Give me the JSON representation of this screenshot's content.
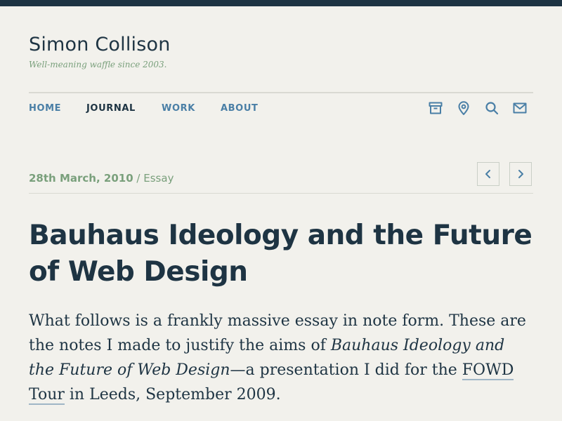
{
  "site": {
    "title": "Simon Collison",
    "tagline": "Well-meaning waffle since 2003."
  },
  "nav": {
    "items": [
      {
        "label": "HOME",
        "active": false
      },
      {
        "label": "JOURNAL",
        "active": true
      },
      {
        "label": "WORK",
        "active": false
      },
      {
        "label": "ABOUT",
        "active": false
      }
    ],
    "icons": [
      "archive-icon",
      "location-icon",
      "search-icon",
      "mail-icon"
    ]
  },
  "article": {
    "date": "28th March, 2010",
    "separator": "/",
    "category": "Essay",
    "title": "Bauhaus Ideology and the Future of Web Design",
    "intro": {
      "part1": "What follows is a frankly massive essay in note form. These are the notes I made to justify the aims of ",
      "italic": "Bauhaus Ideology and the Future of Web Design",
      "part2": "—a presentation I did for the ",
      "link": "FOWD Tour",
      "part3": " in Leeds, September 2009."
    }
  },
  "colors": {
    "background": "#f2f1ec",
    "ink": "#1e3443",
    "link_blue": "#4a7fa6",
    "accent_green": "#7aa07c"
  }
}
